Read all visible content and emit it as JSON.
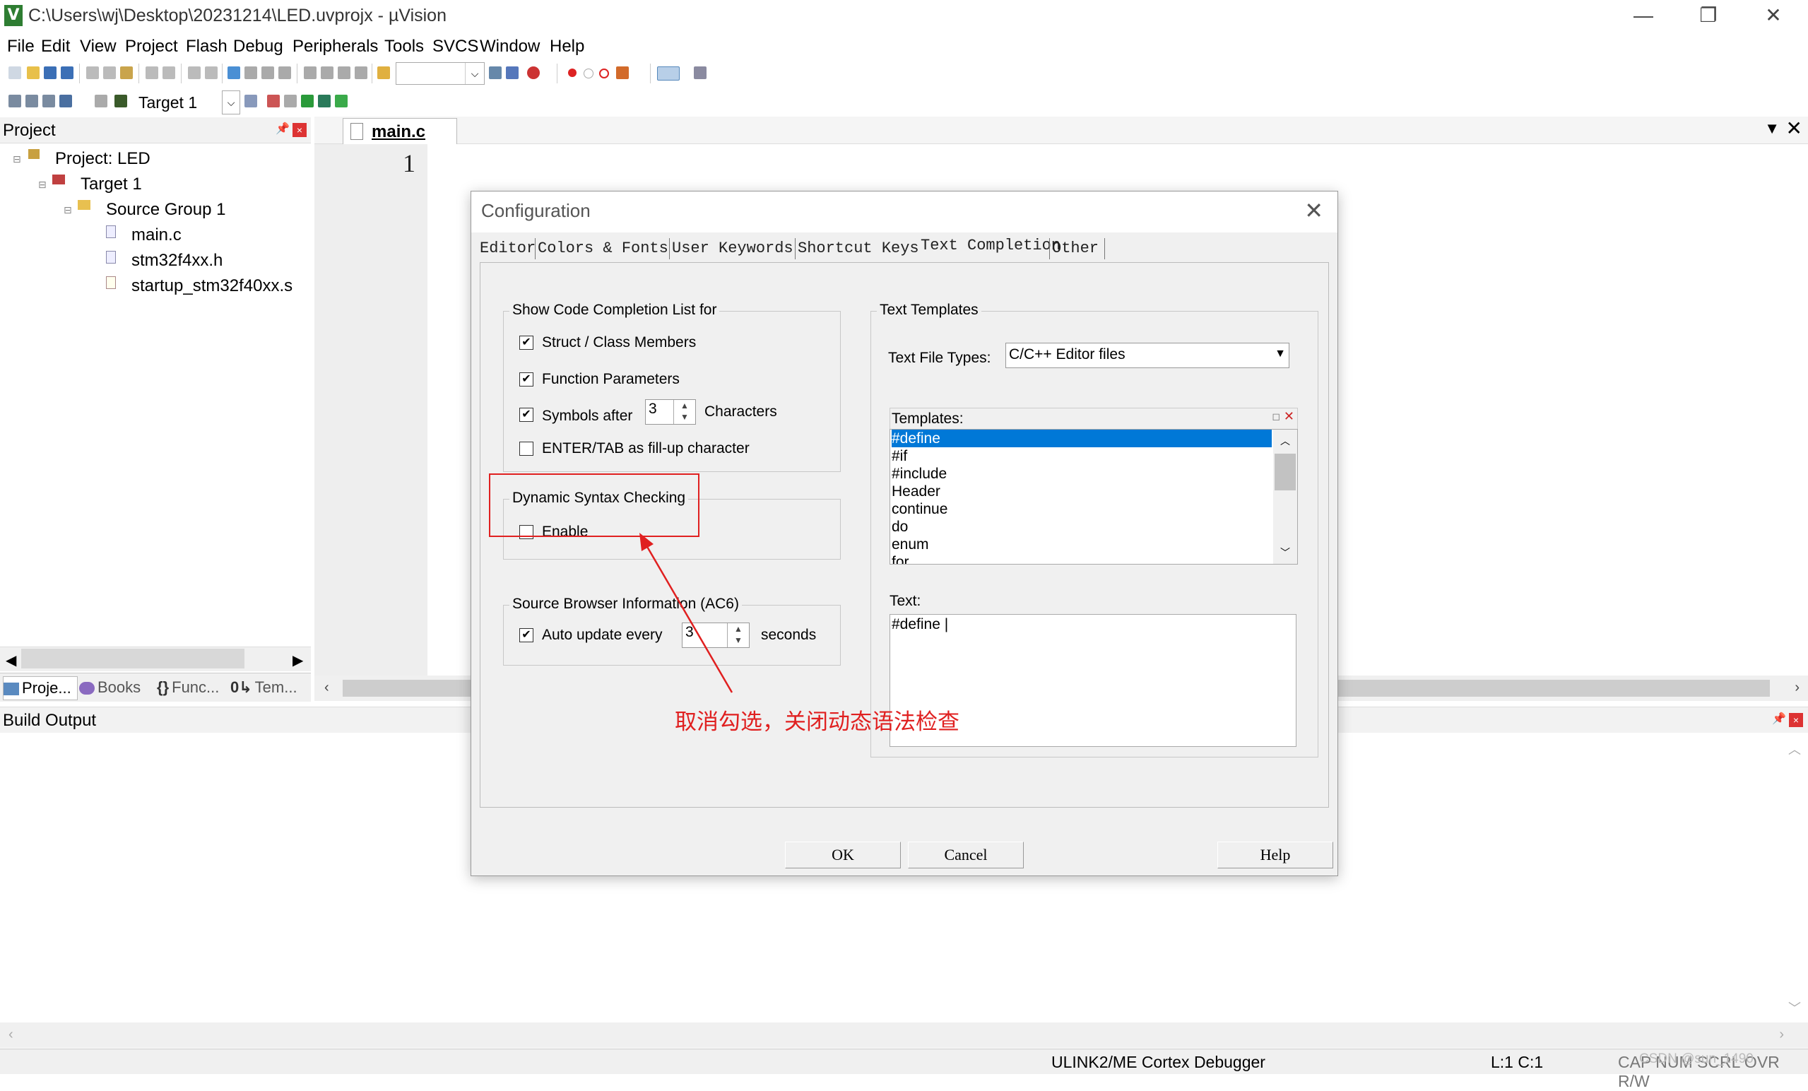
{
  "window": {
    "title": "C:\\Users\\wj\\Desktop\\20231214\\LED.uvprojx - µVision",
    "app_icon": "V",
    "controls": {
      "minimize": "—",
      "restore": "❐",
      "close": "✕"
    }
  },
  "menu": [
    "File",
    "Edit",
    "View",
    "Project",
    "Flash",
    "Debug",
    "Peripherals",
    "Tools",
    "SVCS",
    "Window",
    "Help"
  ],
  "toolbar2": {
    "target_select": "Target 1"
  },
  "project_panel": {
    "title": "Project",
    "tree": [
      {
        "label": "Project: LED"
      },
      {
        "label": "Target 1"
      },
      {
        "label": "Source Group 1"
      },
      {
        "label": "main.c"
      },
      {
        "label": "stm32f4xx.h"
      },
      {
        "label": "startup_stm32f40xx.s"
      }
    ],
    "tabs": [
      "Proje...",
      "Books",
      "Func...",
      "Tem..."
    ],
    "tab_icons": [
      "project-icon",
      "books-icon",
      "braces-icon",
      "template-icon"
    ]
  },
  "editor": {
    "tab": "main.c",
    "line_number": "1"
  },
  "build_output": {
    "title": "Build Output"
  },
  "status_bar": {
    "debugger": "ULINK2/ME Cortex Debugger",
    "position": "L:1 C:1",
    "flags": "CAP NUM SCRL OVR R/W",
    "watermark": "CSDN @sun_1490"
  },
  "dialog": {
    "title": "Configuration",
    "close": "✕",
    "tabs": [
      "Editor",
      "Colors & Fonts",
      "User Keywords",
      "Shortcut Keys",
      "Text Completion",
      "Other"
    ],
    "active_tab": "Text Completion",
    "completion_group": {
      "label": "Show Code Completion List for",
      "struct_members": {
        "label": "Struct / Class Members",
        "checked": true
      },
      "function_params": {
        "label": "Function Parameters",
        "checked": true
      },
      "symbols_after": {
        "label": "Symbols after",
        "value": "3",
        "suffix": "Characters",
        "checked": true
      },
      "enter_tab": {
        "label": "ENTER/TAB as fill-up character",
        "checked": false
      }
    },
    "syntax_group": {
      "label": "Dynamic Syntax Checking",
      "enable": {
        "label": "Enable",
        "checked": false
      }
    },
    "browser_group": {
      "label": "Source Browser Information (AC6)",
      "auto_update": {
        "label": "Auto update every",
        "value": "3",
        "suffix": "seconds",
        "checked": true
      }
    },
    "templates_group": {
      "label": "Text Templates",
      "file_types_label": "Text File Types:",
      "file_types_value": "C/C++ Editor files",
      "templates_label": "Templates:",
      "templates": [
        "#define",
        "#if",
        "#include",
        "Header",
        "continue",
        "do",
        "enum",
        "for"
      ],
      "selected_template": "#define",
      "text_label": "Text:",
      "text_value": "#define |"
    },
    "buttons": {
      "ok": "OK",
      "cancel": "Cancel",
      "help": "Help"
    }
  },
  "annotation": {
    "text": "取消勾选，关闭动态语法检查",
    "color": "#e02020"
  },
  "colors": {
    "selection": "#0078d7",
    "annotation_red": "#e02020"
  }
}
